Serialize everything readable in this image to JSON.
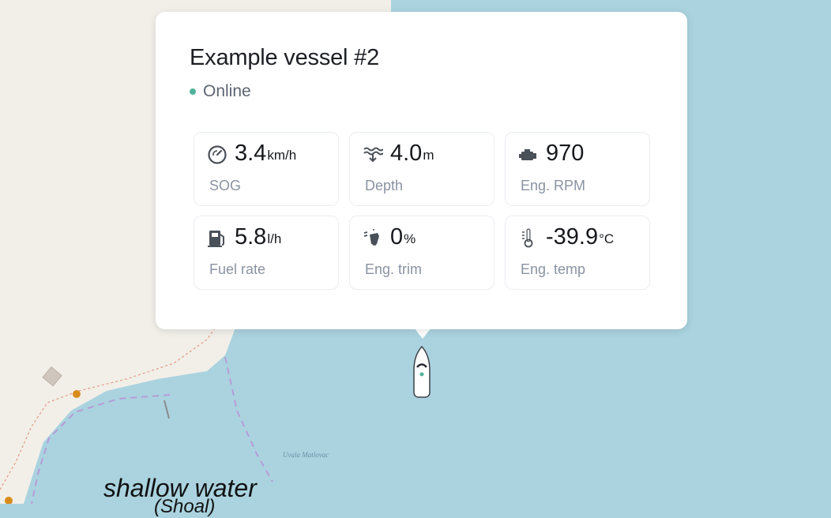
{
  "vessel": {
    "name": "Example vessel #2",
    "status": "Online",
    "status_color": "#4fb39a"
  },
  "metrics": [
    {
      "id": "sog",
      "icon": "speedometer-icon",
      "value": "3.4",
      "unit": "km/h",
      "label": "SOG"
    },
    {
      "id": "depth",
      "icon": "depth-waves-icon",
      "value": "4.0",
      "unit": "m",
      "label": "Depth"
    },
    {
      "id": "rpm",
      "icon": "engine-icon",
      "value": "970",
      "unit": "",
      "label": "Eng. RPM"
    },
    {
      "id": "fuel",
      "icon": "fuel-pump-icon",
      "value": "5.8",
      "unit": "l/h",
      "label": "Fuel rate"
    },
    {
      "id": "trim",
      "icon": "engine-trim-icon",
      "value": "0",
      "unit": "%",
      "label": "Eng. trim"
    },
    {
      "id": "temp",
      "icon": "thermometer-icon",
      "value": "-39.9",
      "unit": "°C",
      "label": "Eng. temp"
    }
  ],
  "map": {
    "place_label": "Uvala Matlovac",
    "shallow_label": "shallow water",
    "shallow_sub_label": "(Shoal)",
    "water_color": "#aad3df",
    "land_color": "#f2efe9"
  }
}
